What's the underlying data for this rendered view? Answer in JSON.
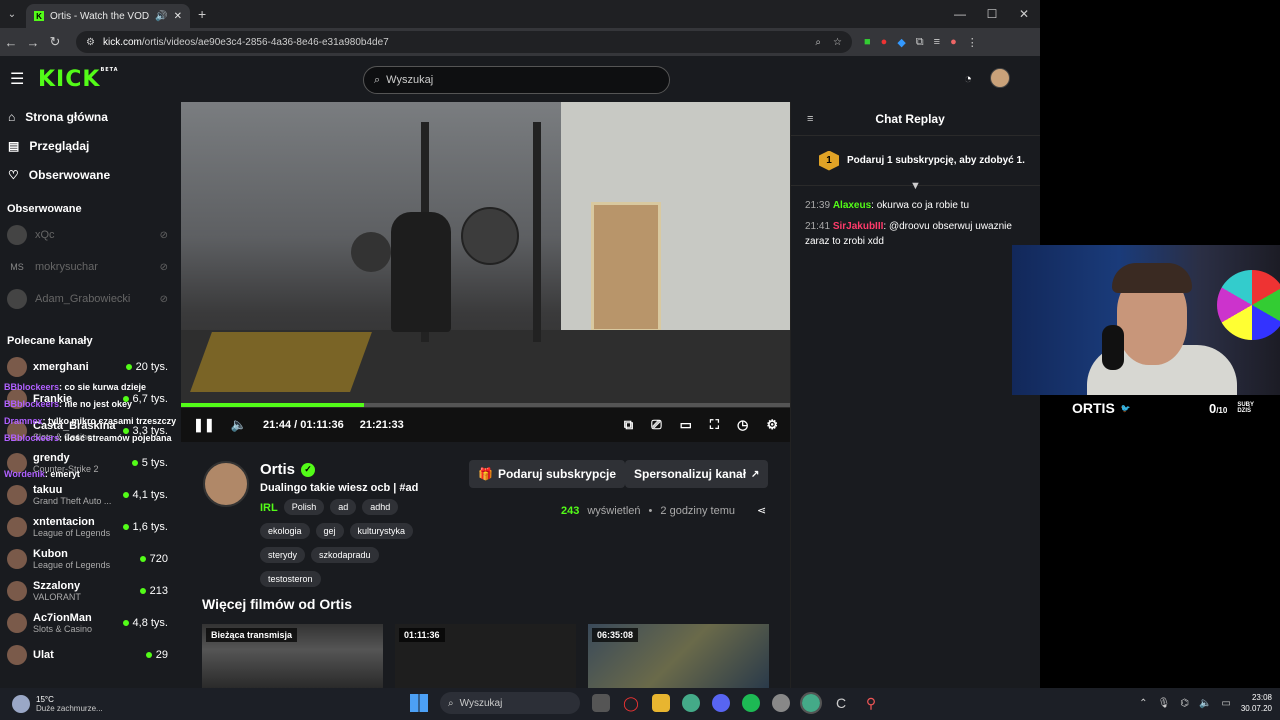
{
  "browser": {
    "tab_title": "Ortis - Watch the VOD on K",
    "url_domain": "kick.com",
    "url_path": "/ortis/videos/ae90e3c4-2856-4a36-8e46-e31a980b4de7"
  },
  "kick": {
    "logo": "KICK",
    "logo_badge": "BETA",
    "search_placeholder": "Wyszukaj",
    "nav": [
      "Strona główna",
      "Przeglądaj",
      "Obserwowane"
    ],
    "followed_title": "Obserwowane",
    "followed": [
      {
        "name": "xQc"
      },
      {
        "name": "mokrysuchar",
        "initials": "MS"
      },
      {
        "name": "Adam_Grabowiecki"
      }
    ],
    "recommended_title": "Polecane kanały",
    "recommended": [
      {
        "name": "xmerghani",
        "game": "",
        "viewers": "20 tys."
      },
      {
        "name": "Frankie",
        "game": "",
        "viewers": "6,7 tys."
      },
      {
        "name": "Casta_Braskina",
        "game": "Slots & Casino",
        "viewers": "3,3 tys."
      },
      {
        "name": "grendy",
        "game": "Counter-Strike 2",
        "viewers": "5 tys."
      },
      {
        "name": "takuu",
        "game": "Grand Theft Auto ...",
        "viewers": "4,1 tys."
      },
      {
        "name": "xntentacion",
        "game": "League of Legends",
        "viewers": "1,6 tys."
      },
      {
        "name": "Kubon",
        "game": "League of Legends",
        "viewers": "720"
      },
      {
        "name": "Szzalony",
        "game": "VALORANT",
        "viewers": "213"
      },
      {
        "name": "Ac7ionMan",
        "game": "Slots & Casino",
        "viewers": "4,8 tys."
      },
      {
        "name": "Ulat",
        "game": "",
        "viewers": "29"
      }
    ]
  },
  "player": {
    "time_current": "21:44",
    "time_total": "01:11:36",
    "time_remaining": "21:21:33",
    "progress": 0.3
  },
  "channel": {
    "name": "Ortis",
    "title": "Dualingo takie wiesz ocb | #ad",
    "category": "IRL",
    "tags": [
      "Polish",
      "ad",
      "adhd",
      "ekologia",
      "gej",
      "kulturystyka",
      "sterydy",
      "szkodapradu",
      "testosteron"
    ],
    "btn_sub": "Podaruj subskrypcje",
    "btn_custom": "Spersonalizuj kanał",
    "views": "243",
    "views_label": "wyświetleń",
    "ago": "2 godziny temu"
  },
  "more": {
    "title": "Więcej filmów od Ortis",
    "videos": [
      "Bieżąca transmisja",
      "01:11:36",
      "06:35:08"
    ]
  },
  "chat": {
    "title": "Chat Replay",
    "gift": "Podaruj 1 subskrypcję, aby zdobyć 1.",
    "gift_badge": "1",
    "messages": [
      {
        "time": "21:39",
        "user": "Alaxeus",
        "color": "#53fc18",
        "text": "okurwa co ja robie tu"
      },
      {
        "time": "21:41",
        "user": "SirJakubIII",
        "color": "#ff3b6b",
        "text": "@droovu obserwuj uwaznie zaraz to zrobi xdd"
      }
    ]
  },
  "overlay": {
    "brand": "ORTIS",
    "count": "0",
    "count_of": "/10",
    "sub1": "SUBY",
    "sub2": "DZIŚ",
    "chat_lines": [
      {
        "user": "BBblockeers",
        "text": "co sie kurwa dzieje"
      },
      {
        "user": "BBblockeers",
        "text": "nie no jest okey"
      },
      {
        "user": "Dramnex",
        "text": "tylko mikro czasami trzeszczy"
      },
      {
        "user": "BBblockeers",
        "text": "ilość streamów pojebana"
      },
      {
        "user": "Wordenik",
        "text": "emeryt"
      }
    ]
  },
  "taskbar": {
    "temp": "15°C",
    "weather": "Duże zachmurze...",
    "search": "Wyszukaj",
    "time": "23:08",
    "date": "30.07.20"
  }
}
